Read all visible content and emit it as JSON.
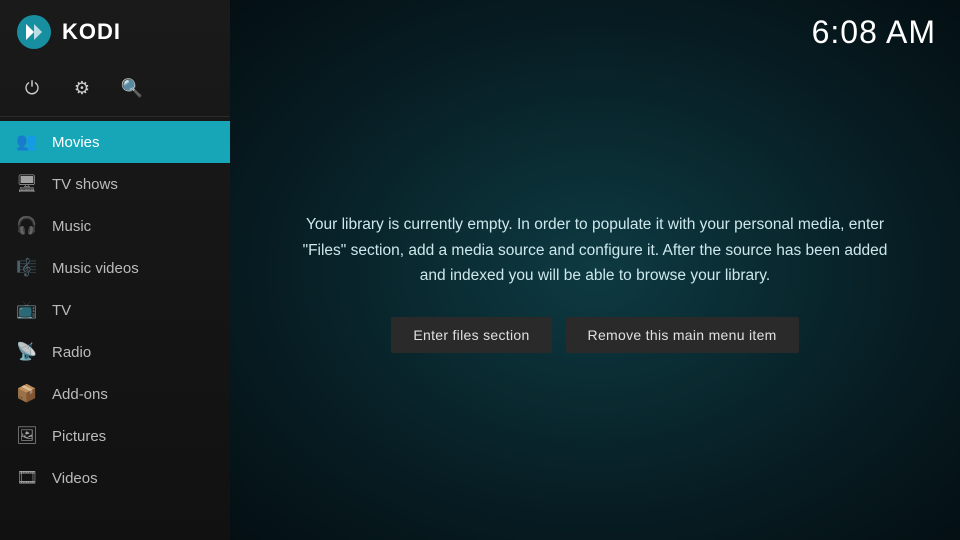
{
  "sidebar": {
    "logo_text": "KODI",
    "icons": [
      {
        "name": "power-icon",
        "symbol": "⏻"
      },
      {
        "name": "settings-icon",
        "symbol": "⚙"
      },
      {
        "name": "search-icon",
        "symbol": "🔍"
      }
    ],
    "menu": [
      {
        "id": "movies",
        "label": "Movies",
        "icon": "🎬",
        "active": true
      },
      {
        "id": "tv-shows",
        "label": "TV shows",
        "icon": "📺",
        "active": false
      },
      {
        "id": "music",
        "label": "Music",
        "icon": "🎧",
        "active": false
      },
      {
        "id": "music-videos",
        "label": "Music videos",
        "icon": "🎵",
        "active": false
      },
      {
        "id": "tv",
        "label": "TV",
        "icon": "📡",
        "active": false
      },
      {
        "id": "radio",
        "label": "Radio",
        "icon": "📻",
        "active": false
      },
      {
        "id": "add-ons",
        "label": "Add-ons",
        "icon": "📦",
        "active": false
      },
      {
        "id": "pictures",
        "label": "Pictures",
        "icon": "🖼",
        "active": false
      },
      {
        "id": "videos",
        "label": "Videos",
        "icon": "🎞",
        "active": false
      }
    ]
  },
  "header": {
    "clock": "6:08 AM"
  },
  "main": {
    "message": "Your library is currently empty. In order to populate it with your personal media, enter \"Files\" section, add a media source and configure it. After the source has been added and indexed you will be able to browse your library.",
    "buttons": [
      {
        "id": "enter-files",
        "label": "Enter files section"
      },
      {
        "id": "remove-menu-item",
        "label": "Remove this main menu item"
      }
    ]
  }
}
